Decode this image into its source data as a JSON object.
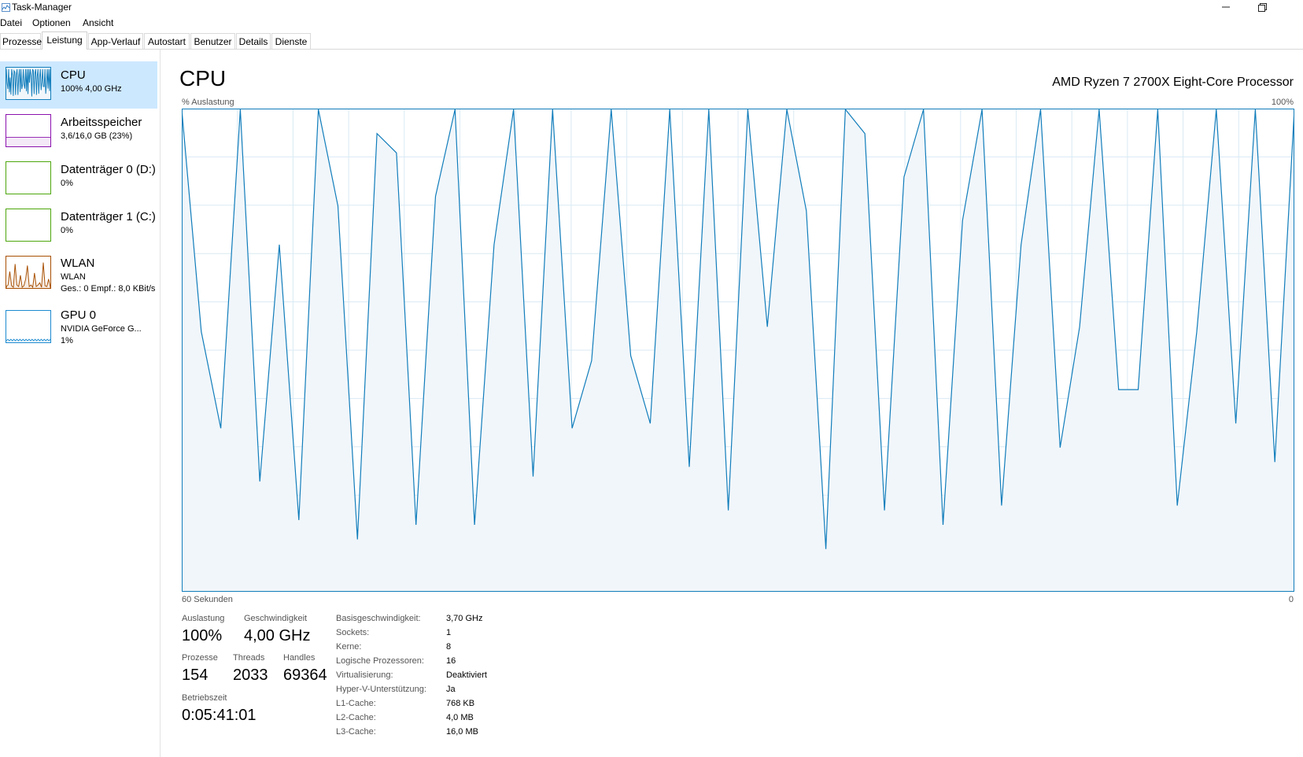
{
  "window": {
    "title": "Task-Manager"
  },
  "menu": [
    "Datei",
    "Optionen",
    "Ansicht"
  ],
  "tabs": [
    {
      "label": "Prozesse"
    },
    {
      "label": "Leistung"
    },
    {
      "label": "App-Verlauf"
    },
    {
      "label": "Autostart"
    },
    {
      "label": "Benutzer"
    },
    {
      "label": "Details"
    },
    {
      "label": "Dienste"
    }
  ],
  "sidebar": {
    "items": [
      {
        "name": "CPU",
        "sub1": "100%  4,00 GHz",
        "sub2": "",
        "sub3": ""
      },
      {
        "name": "Arbeitsspeicher",
        "sub1": "3,6/16,0 GB (23%)",
        "sub2": "",
        "sub3": ""
      },
      {
        "name": "Datenträger 0 (D:)",
        "sub1": "0%",
        "sub2": "",
        "sub3": ""
      },
      {
        "name": "Datenträger 1 (C:)",
        "sub1": "0%",
        "sub2": "",
        "sub3": ""
      },
      {
        "name": "WLAN",
        "sub1": "WLAN",
        "sub2": "Ges.: 0  Empf.: 8,0 KBit/s",
        "sub3": ""
      },
      {
        "name": "GPU 0",
        "sub1": "NVIDIA GeForce G...",
        "sub2": "1%",
        "sub3": ""
      }
    ]
  },
  "colors": {
    "cpu": "#117dbb",
    "memory": "#8b12ae",
    "disk": "#4da60c",
    "wlan": "#a74f01",
    "gpu": "#1b8ad0",
    "selected": "#cce8ff",
    "graph_fill": "#f1f6fa",
    "grid": "#d9eaf4"
  },
  "main": {
    "title": "CPU",
    "model": "AMD Ryzen 7 2700X Eight-Core Processor",
    "y_label": "% Auslastung",
    "y_max": "100%",
    "x_left": "60 Sekunden",
    "x_right": "0"
  },
  "stats": {
    "utilization_label": "Auslastung",
    "utilization": "100%",
    "speed_label": "Geschwindigkeit",
    "speed": "4,00 GHz",
    "processes_label": "Prozesse",
    "processes": "154",
    "threads_label": "Threads",
    "threads": "2033",
    "handles_label": "Handles",
    "handles": "69364",
    "uptime_label": "Betriebszeit",
    "uptime": "0:05:41:01"
  },
  "info": [
    {
      "key": "Basisgeschwindigkeit:",
      "value": "3,70 GHz"
    },
    {
      "key": "Sockets:",
      "value": "1"
    },
    {
      "key": "Kerne:",
      "value": "8"
    },
    {
      "key": "Logische Prozessoren:",
      "value": "16"
    },
    {
      "key": "Virtualisierung:",
      "value": "Deaktiviert"
    },
    {
      "key": "Hyper-V-Unterstützung:",
      "value": "Ja"
    },
    {
      "key": "L1-Cache:",
      "value": "768 KB"
    },
    {
      "key": "L2-Cache:",
      "value": "4,0 MB"
    },
    {
      "key": "L3-Cache:",
      "value": "16,0 MB"
    }
  ],
  "chart_data": {
    "type": "line",
    "ylim": [
      0,
      100
    ],
    "xlim": [
      60,
      0
    ],
    "xlabel": "60 Sekunden",
    "ylabel": "% Auslastung",
    "grid": true,
    "series": [
      {
        "values": [
          100,
          54,
          34,
          100,
          23,
          72,
          15,
          100,
          80,
          11,
          95,
          91,
          14,
          82,
          100,
          14,
          72,
          100,
          24,
          100,
          34,
          48,
          100,
          49,
          35,
          100,
          26,
          100,
          17,
          100,
          55,
          100,
          79,
          9,
          100,
          95,
          17,
          86,
          100,
          14,
          77,
          100,
          18,
          72,
          100,
          30,
          55,
          100,
          42,
          42,
          100,
          18,
          54,
          100,
          35,
          100,
          27,
          100
        ]
      }
    ]
  }
}
